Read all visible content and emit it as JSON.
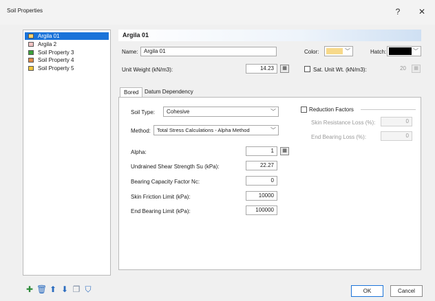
{
  "window": {
    "title": "Soil Properties",
    "help_label": "?",
    "close_label": "✕"
  },
  "soil_list": {
    "items": [
      {
        "label": "Argila 01",
        "color": "#f5d16e",
        "selected": true
      },
      {
        "label": "Argila 2",
        "color": "#f2c4c4"
      },
      {
        "label": "Soil Property 3",
        "color": "#3aa13a"
      },
      {
        "label": "Soil Property 4",
        "color": "#e08a4a"
      },
      {
        "label": "Soil Property 5",
        "color": "#f0c53a"
      }
    ]
  },
  "header": {
    "title": "Argila 01"
  },
  "properties": {
    "name_label": "Name:",
    "name_value": "Argila 01",
    "color_label": "Color:",
    "color_value": "#f7d98a",
    "hatch_label": "Hatch:",
    "hatch_value": "#000000",
    "unit_weight_label": "Unit Weight (kN/m3):",
    "unit_weight_value": "14.23",
    "sat_unit_weight_label": "Sat. Unit Wt. (kN/m3):",
    "sat_unit_weight_value": "20"
  },
  "tabs": [
    {
      "label": "Bored",
      "active": true
    },
    {
      "label": "Datum Dependency"
    }
  ],
  "bored": {
    "soil_type_label": "Soil Type:",
    "soil_type_value": "Cohesive",
    "method_label": "Method:",
    "method_value": "Total Stress Calculations - Alpha Method",
    "alpha_label": "Alpha:",
    "alpha_value": "1",
    "su_label": "Undrained Shear Strength Su (kPa):",
    "su_value": "22.27",
    "nc_label": "Bearing Capacity Factor Nc:",
    "nc_value": "0",
    "skin_friction_label": "Skin Friction Limit (kPa):",
    "skin_friction_value": "10000",
    "end_bearing_label": "End Bearing Limit (kPa):",
    "end_bearing_value": "100000"
  },
  "reduction": {
    "label": "Reduction Factors",
    "skin_loss_label": "Skin Resistance Loss (%):",
    "skin_loss_value": "0",
    "end_loss_label": "End Bearing Loss (%):",
    "end_loss_value": "0"
  },
  "toolbar": {
    "icons": [
      "add-icon",
      "delete-icon",
      "move-up-icon",
      "move-down-icon",
      "copy-icon",
      "filter-icon"
    ]
  },
  "buttons": {
    "ok_label": "OK",
    "cancel_label": "Cancel"
  }
}
